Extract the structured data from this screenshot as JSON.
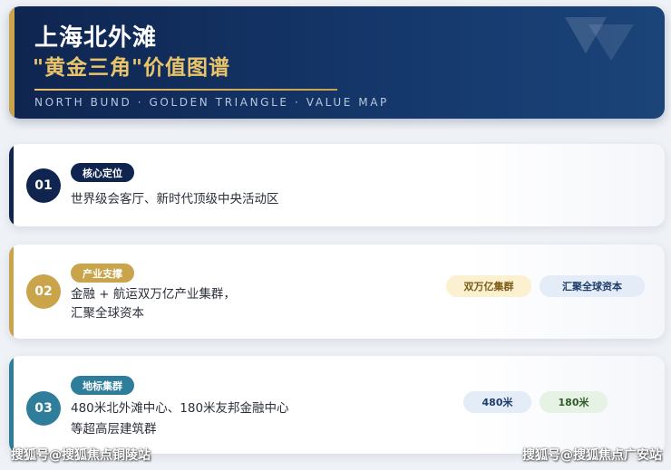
{
  "header": {
    "title": "上海北外滩",
    "subtitle": "\"黄金三角\"价值图谱",
    "subtitle_en": "NORTH BUND  ·  GOLDEN TRIANGLE  ·  VALUE MAP"
  },
  "cards": [
    {
      "number": "01",
      "tag": "核心定位",
      "line1": "世界级会客厅、新时代顶级中央活动区",
      "line2": ""
    },
    {
      "number": "02",
      "tag": "产业支撑",
      "line1": "金融 + 航运双万亿产业集群，",
      "line2": "汇聚全球资本",
      "pills": [
        "双万亿集群",
        "汇聚全球资本"
      ]
    },
    {
      "number": "03",
      "tag": "地标集群",
      "line1": "480米北外滩中心、180米友邦金融中心",
      "line2": "等超高层建筑群",
      "pills": [
        "480米",
        "180米"
      ]
    }
  ],
  "watermarks": {
    "left": "搜狐号@搜狐焦点铜陵站",
    "right": "搜狐号@搜狐焦点广安站"
  },
  "colors": {
    "navy": "#0f2550",
    "gold": "#c9a44a",
    "teal": "#2e7d9a",
    "cream_pill": "#fbf0cf",
    "blue_pill": "#e3ecf7",
    "green_pill": "#e6f2e3"
  }
}
